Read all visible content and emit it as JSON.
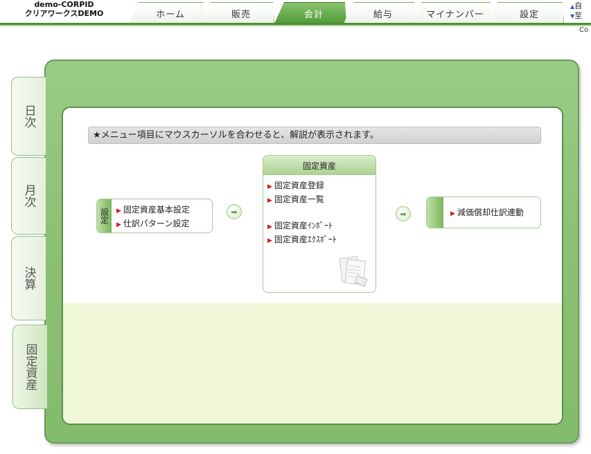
{
  "header": {
    "company_id": "demo-CORPID",
    "company_name": "クリアワークスDEMO",
    "tabs": [
      {
        "label": "ホーム",
        "active": false
      },
      {
        "label": "販売",
        "active": false
      },
      {
        "label": "会計",
        "active": true
      },
      {
        "label": "給与",
        "active": false
      },
      {
        "label": "マイナンバー",
        "active": false
      },
      {
        "label": "設定",
        "active": false
      }
    ],
    "right_links": [
      "自",
      "至"
    ],
    "right_small_text": "Co"
  },
  "side_tabs": [
    {
      "label": "日次",
      "active": false
    },
    {
      "label": "月次",
      "active": false
    },
    {
      "label": "決算",
      "active": false
    },
    {
      "label": "固定資産",
      "active": true
    }
  ],
  "notice": "★メニュー項目にマウスカーソルを合わせると、解説が表示されます。",
  "settings_box": {
    "label": "設定",
    "links": [
      "固定資産基本設定",
      "仕訳パターン設定"
    ]
  },
  "fixed_assets_box": {
    "title": "固定資産",
    "links_group1": [
      "固定資産登録",
      "固定資産一覧"
    ],
    "links_group2": [
      "固定資産ｲﾝﾎﾟｰﾄ",
      "固定資産ｴｸｽﾎﾟｰﾄ"
    ]
  },
  "depreciation_box": {
    "link": "減価償却仕訳連動"
  },
  "colors": {
    "accent_green": "#4f9a36",
    "panel_green": "#8dc277",
    "lower_area": "#f1f7d9",
    "bullet_red": "#d81a1a"
  }
}
